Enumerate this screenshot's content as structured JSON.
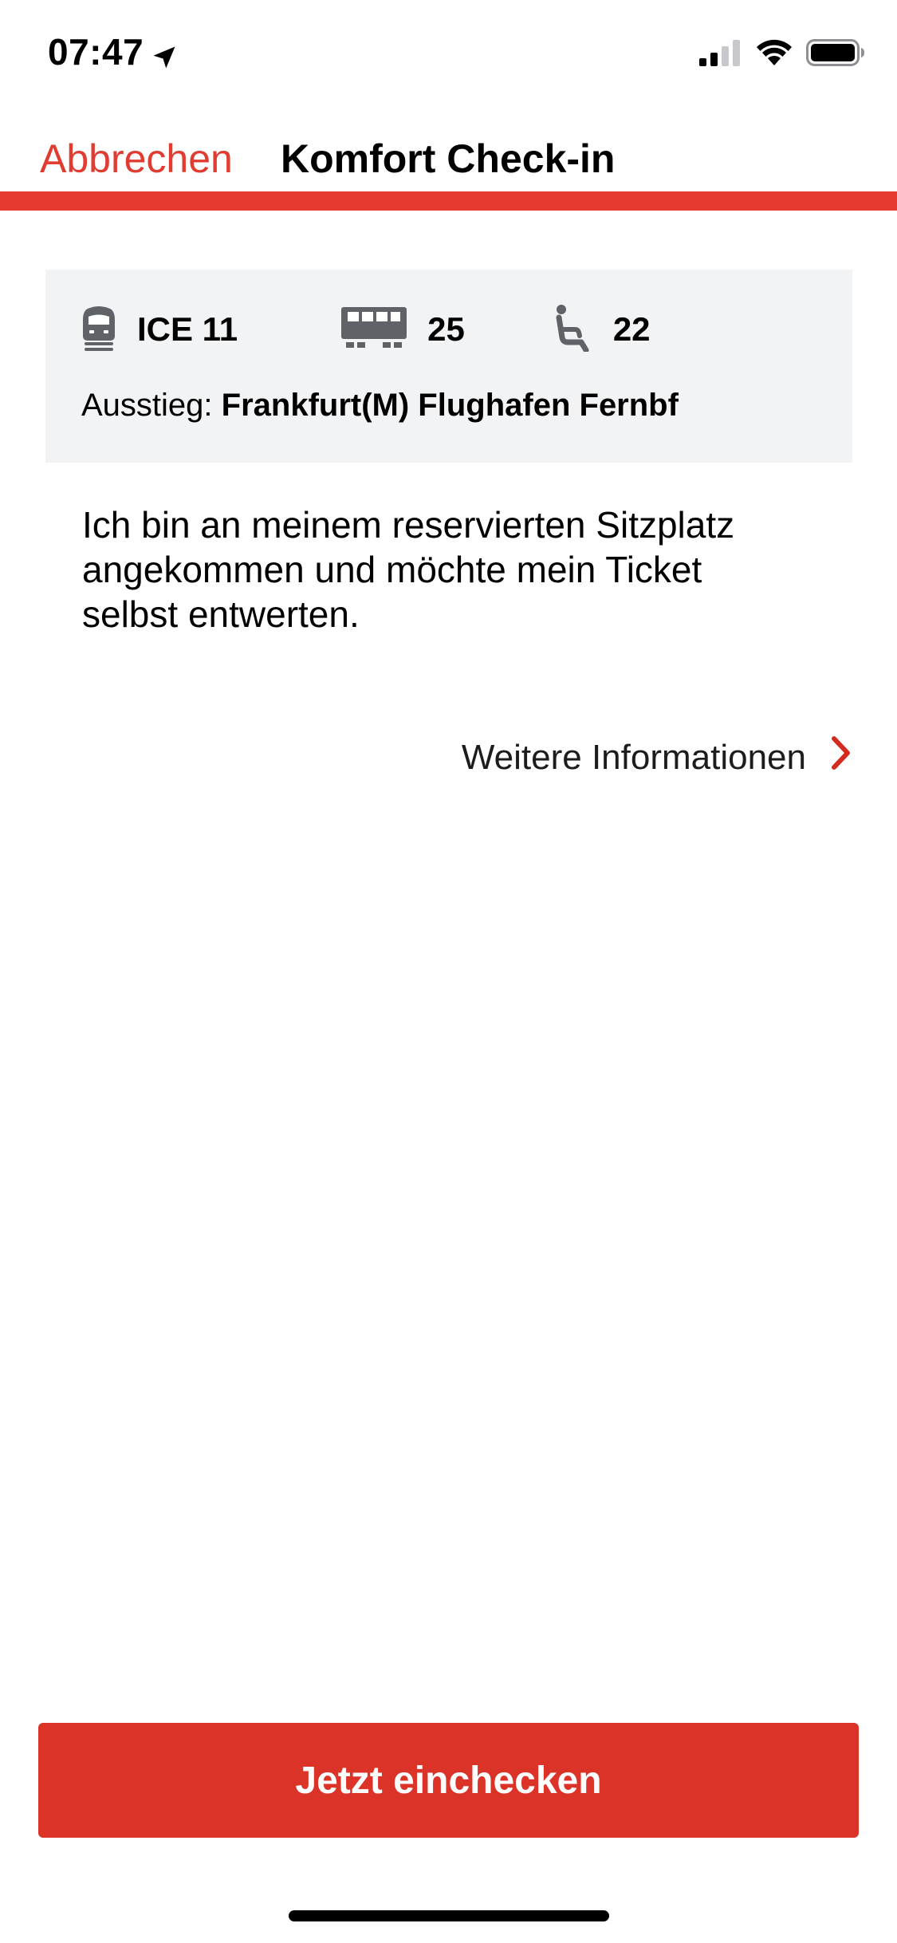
{
  "status_bar": {
    "time": "07:47",
    "icons": [
      "location-arrow-icon",
      "cellular-signal-icon",
      "wifi-icon",
      "battery-icon"
    ]
  },
  "nav": {
    "cancel_label": "Abbrechen",
    "title": "Komfort Check-in"
  },
  "trip_card": {
    "train_icon": "train-icon",
    "train": "ICE 11",
    "coach_icon": "coach-icon",
    "coach": "25",
    "seat_icon": "seat-icon",
    "seat": "22",
    "exit_label": "Ausstieg:",
    "exit_station": "Frankfurt(M) Flughafen Fernbf"
  },
  "body": {
    "text": "Ich bin an meinem reservierten Sitzplatz angekommen und möchte mein Ticket selbst entwerten."
  },
  "more_info": {
    "label": "Weitere Informationen",
    "icon": "chevron-right-icon"
  },
  "primary_button": {
    "label": "Jetzt einchecken"
  },
  "colors": {
    "accent_red": "#e63a2e",
    "button_red": "#dc3328",
    "card_bg": "#f2f3f5",
    "icon_gray": "#5f6368"
  }
}
